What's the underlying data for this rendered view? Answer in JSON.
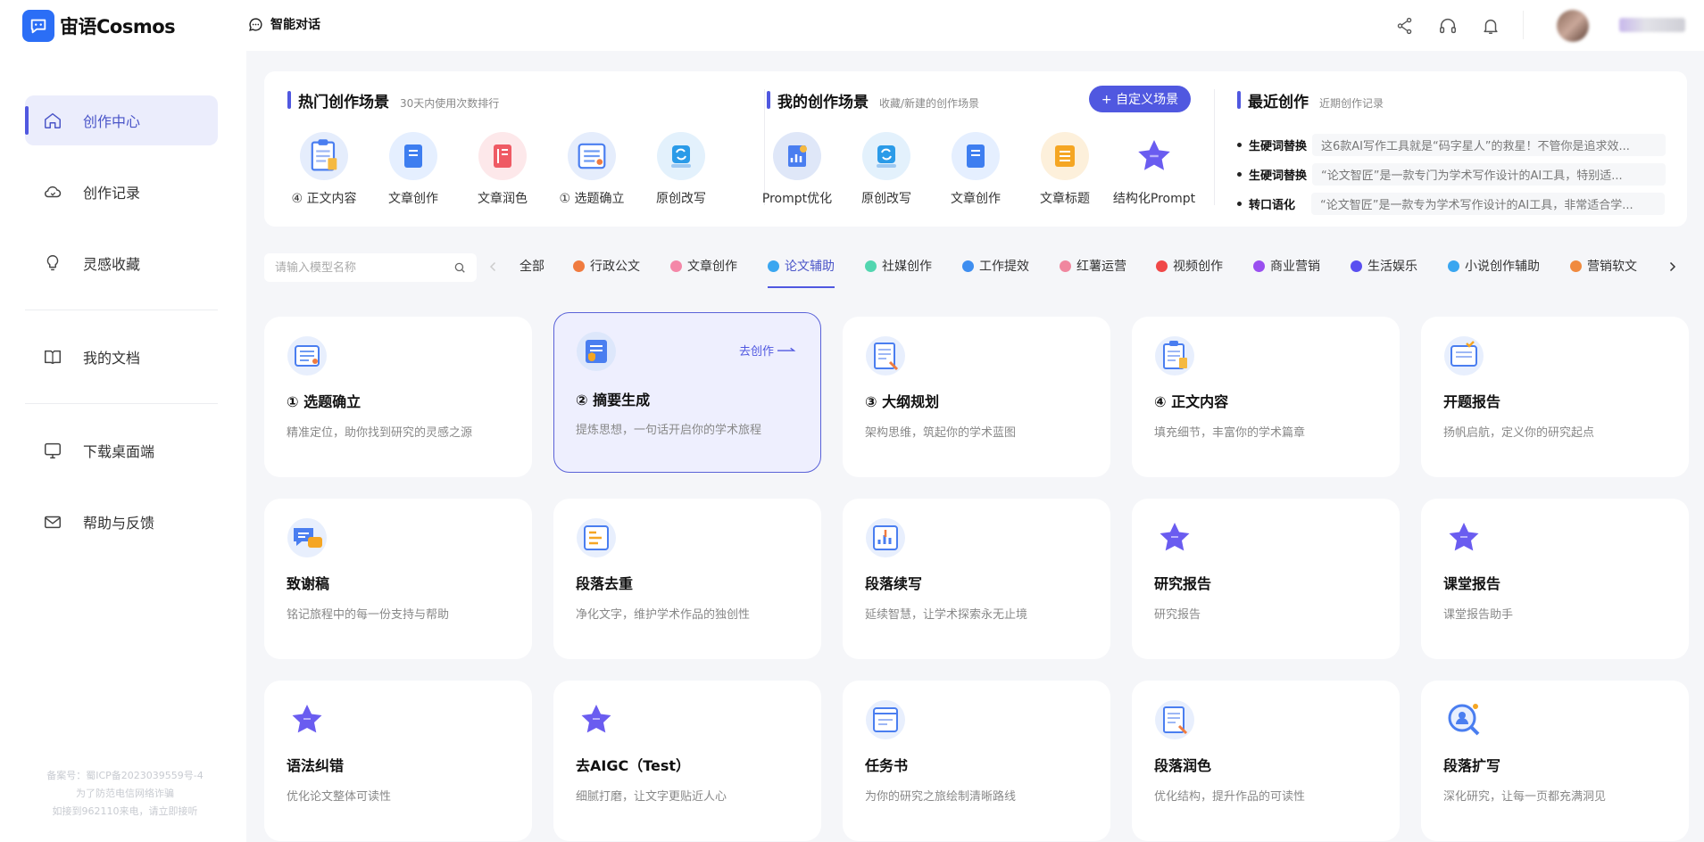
{
  "app": {
    "name": "宙语Cosmos"
  },
  "sidebar": {
    "items": [
      {
        "label": "创作中心",
        "icon": "home-icon",
        "active": true
      },
      {
        "label": "创作记录",
        "icon": "cloud-icon"
      },
      {
        "label": "灵感收藏",
        "icon": "lightbulb-icon"
      },
      {
        "label": "我的文档",
        "icon": "book-icon"
      },
      {
        "label": "下载桌面端",
        "icon": "monitor-icon"
      },
      {
        "label": "帮助与反馈",
        "icon": "mail-icon"
      }
    ],
    "footer": [
      "备案号：蜀ICP备2023039559号-4",
      "为了防范电信网络诈骗",
      "如接到962110来电，请立即接听"
    ]
  },
  "topbar": {
    "title": "智能对话",
    "icons": [
      "share-icon",
      "headset-icon",
      "bell-icon"
    ]
  },
  "hot": {
    "title": "热门创作场景",
    "subtitle": "30天内使用次数排行",
    "items": [
      "④ 正文内容",
      "文章创作",
      "文章润色",
      "① 选题确立",
      "原创改写"
    ]
  },
  "mine": {
    "title": "我的创作场景",
    "subtitle": "收藏/新建的创作场景",
    "button": "+ 自定义场景",
    "items": [
      "Prompt优化",
      "原创改写",
      "文章创作",
      "文章标题",
      "结构化Prompt"
    ]
  },
  "recent": {
    "title": "最近创作",
    "subtitle": "近期创作记录",
    "items": [
      {
        "tag": "生硬词替换",
        "text": "这6款AI写作工具就是“码字星人”的救星！不管你是追求效..."
      },
      {
        "tag": "生硬词替换",
        "text": "“论文智匠”是一款专门为学术写作设计的AI工具，特别适..."
      },
      {
        "tag": "转口语化",
        "text": "“论文智匠”是一款专为学术写作设计的AI工具，非常适合学..."
      }
    ]
  },
  "search": {
    "placeholder": "请输入模型名称"
  },
  "categories": [
    {
      "label": "全部",
      "color": ""
    },
    {
      "label": "行政公文",
      "color": "#f07b3f"
    },
    {
      "label": "文章创作",
      "color": "#f487a8"
    },
    {
      "label": "论文辅助",
      "color": "#3aa6f0",
      "active": true
    },
    {
      "label": "社媒创作",
      "color": "#52d6b0"
    },
    {
      "label": "工作提效",
      "color": "#3e8ef0"
    },
    {
      "label": "红薯运营",
      "color": "#f0879f"
    },
    {
      "label": "视频创作",
      "color": "#f04848"
    },
    {
      "label": "商业营销",
      "color": "#9a4ff0"
    },
    {
      "label": "生活娱乐",
      "color": "#5a4ff0"
    },
    {
      "label": "小说创作辅助",
      "color": "#3aa6f0"
    },
    {
      "label": "营销软文",
      "color": "#f08a3f"
    }
  ],
  "cards": [
    {
      "title": "① 选题确立",
      "desc": "精准定位，助你找到研究的灵感之源",
      "icon": "checklist-icon"
    },
    {
      "title": "② 摘要生成",
      "desc": "提炼思想，一句话开启你的学术旅程",
      "icon": "document-shield-icon",
      "go": "去创作"
    },
    {
      "title": "③ 大纲规划",
      "desc": "架构思维，筑起你的学术蓝图",
      "icon": "document-pen-icon"
    },
    {
      "title": "④ 正文内容",
      "desc": "填充细节，丰富你的学术篇章",
      "icon": "clipboard-icon"
    },
    {
      "title": "开题报告",
      "desc": "扬帆启航，定义你的研究起点",
      "icon": "report-check-icon"
    },
    {
      "title": "致谢稿",
      "desc": "铭记旅程中的每一份支持与帮助",
      "icon": "chat-bubble-icon"
    },
    {
      "title": "段落去重",
      "desc": "净化文字，维护学术作品的独创性",
      "icon": "list-edit-icon"
    },
    {
      "title": "段落续写",
      "desc": "延续智慧，让学术探索永无止境",
      "icon": "chart-arrow-icon"
    },
    {
      "title": "研究报告",
      "desc": "研究报告",
      "icon": "star-icon"
    },
    {
      "title": "课堂报告",
      "desc": "课堂报告助手",
      "icon": "star-icon"
    },
    {
      "title": "语法纠错",
      "desc": "优化论文整体可读性",
      "icon": "star-icon"
    },
    {
      "title": "去AIGC（Test）",
      "desc": "细腻打磨，让文字更贴近人心",
      "icon": "star-icon"
    },
    {
      "title": "任务书",
      "desc": "为你的研究之旅绘制清晰路线",
      "icon": "window-doc-icon"
    },
    {
      "title": "段落润色",
      "desc": "优化结构，提升作品的可读性",
      "icon": "document-pen-icon"
    },
    {
      "title": "段落扩写",
      "desc": "深化研究，让每一页都充满洞见",
      "icon": "search-user-icon"
    }
  ]
}
